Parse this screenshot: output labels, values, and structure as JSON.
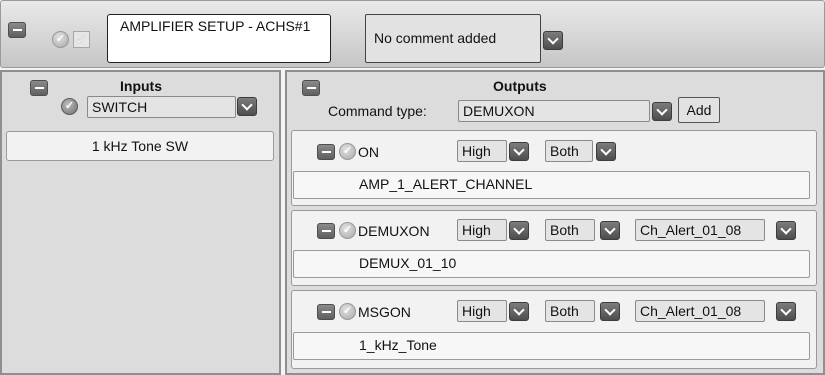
{
  "header": {
    "title": "AMPLIFIER SETUP - ACHS#1",
    "comment": "No comment added"
  },
  "inputs": {
    "title": "Inputs",
    "type_value": "SWITCH",
    "items": [
      "1 kHz Tone SW"
    ]
  },
  "outputs": {
    "title": "Outputs",
    "command_type_label": "Command type:",
    "command_type_value": "DEMUXON",
    "add_label": "Add",
    "commands": [
      {
        "name": "ON",
        "level": "High",
        "edge": "Both",
        "value": "AMP_1_ALERT_CHANNEL"
      },
      {
        "name": "DEMUXON",
        "level": "High",
        "edge": "Both",
        "channel": "Ch_Alert_01_08",
        "value": "DEMUX_01_10"
      },
      {
        "name": "MSGON",
        "level": "High",
        "edge": "Both",
        "channel": "Ch_Alert_01_08",
        "value": "1_kHz_Tone"
      }
    ]
  }
}
